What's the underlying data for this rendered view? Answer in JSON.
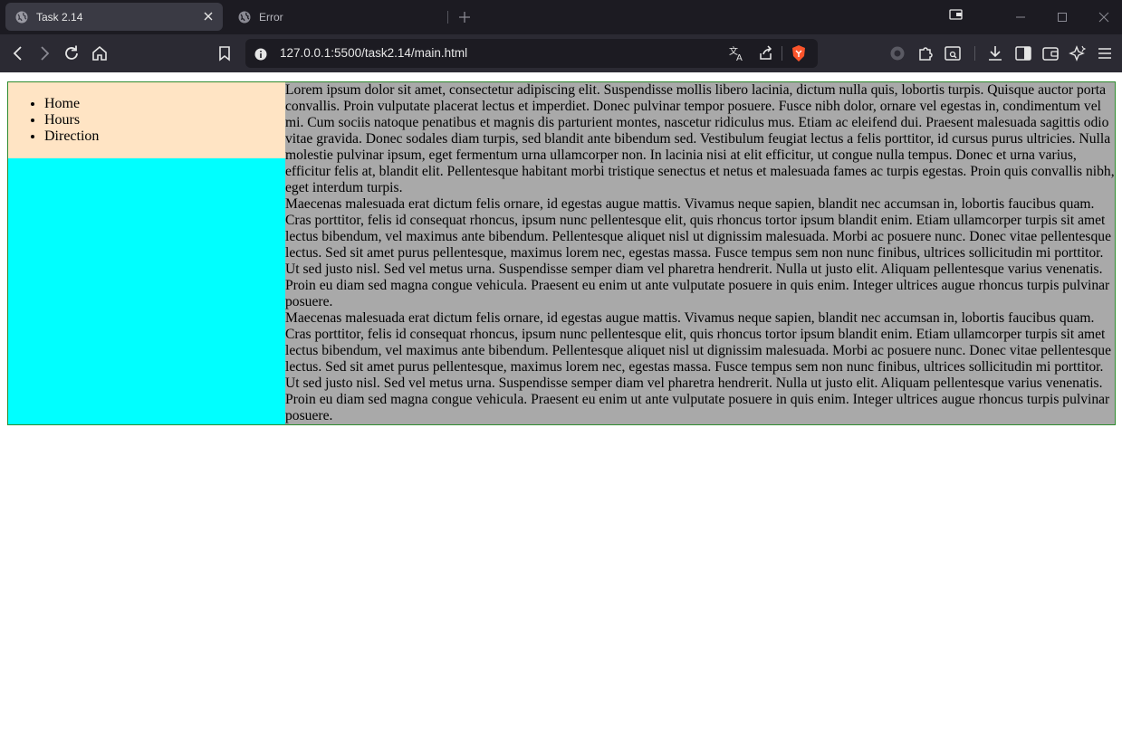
{
  "browser": {
    "tabs": [
      {
        "title": "Task 2.14",
        "active": true
      },
      {
        "title": "Error",
        "active": false
      }
    ],
    "url": "127.0.0.1:5500/task2.14/main.html",
    "colors": {
      "tabbar": "#1c1b22",
      "toolbar": "#2b2a33",
      "urlbar": "#1c1b22",
      "brave": "#fb542b"
    }
  },
  "page": {
    "nav": {
      "items": [
        "Home",
        "Hours",
        "Direction"
      ]
    },
    "content": {
      "paragraphs": [
        "Lorem ipsum dolor sit amet, consectetur adipiscing elit. Suspendisse mollis libero lacinia, dictum nulla quis, lobortis turpis. Quisque auctor porta convallis. Proin vulputate placerat lectus et imperdiet. Donec pulvinar tempor posuere. Fusce nibh dolor, ornare vel egestas in, condimentum vel mi. Cum sociis natoque penatibus et magnis dis parturient montes, nascetur ridiculus mus. Etiam ac eleifend dui. Praesent malesuada sagittis odio vitae gravida. Donec sodales diam turpis, sed blandit ante bibendum sed. Vestibulum feugiat lectus a felis porttitor, id cursus purus ultricies. Nulla molestie pulvinar ipsum, eget fermentum urna ullamcorper non. In lacinia nisi at elit efficitur, ut congue nulla tempus. Donec et urna varius, efficitur felis at, blandit elit. Pellentesque habitant morbi tristique senectus et netus et malesuada fames ac turpis egestas. Proin quis convallis nibh, eget interdum turpis.",
        "Maecenas malesuada erat dictum felis ornare, id egestas augue mattis. Vivamus neque sapien, blandit nec accumsan in, lobortis faucibus quam. Cras porttitor, felis id consequat rhoncus, ipsum nunc pellentesque elit, quis rhoncus tortor ipsum blandit enim. Etiam ullamcorper turpis sit amet lectus bibendum, vel maximus ante bibendum. Pellentesque aliquet nisl ut dignissim malesuada. Morbi ac posuere nunc. Donec vitae pellentesque lectus. Sed sit amet purus pellentesque, maximus lorem nec, egestas massa. Fusce tempus sem non nunc finibus, ultrices sollicitudin mi porttitor. Ut sed justo nisl. Sed vel metus urna. Suspendisse semper diam vel pharetra hendrerit. Nulla ut justo elit. Aliquam pellentesque varius venenatis. Proin eu diam sed magna congue vehicula. Praesent eu enim ut ante vulputate posuere in quis enim. Integer ultrices augue rhoncus turpis pulvinar posuere.",
        "Maecenas malesuada erat dictum felis ornare, id egestas augue mattis. Vivamus neque sapien, blandit nec accumsan in, lobortis faucibus quam. Cras porttitor, felis id consequat rhoncus, ipsum nunc pellentesque elit, quis rhoncus tortor ipsum blandit enim. Etiam ullamcorper turpis sit amet lectus bibendum, vel maximus ante bibendum. Pellentesque aliquet nisl ut dignissim malesuada. Morbi ac posuere nunc. Donec vitae pellentesque lectus. Sed sit amet purus pellentesque, maximus lorem nec, egestas massa. Fusce tempus sem non nunc finibus, ultrices sollicitudin mi porttitor. Ut sed justo nisl. Sed vel metus urna. Suspendisse semper diam vel pharetra hendrerit. Nulla ut justo elit. Aliquam pellentesque varius venenatis. Proin eu diam sed magna congue vehicula. Praesent eu enim ut ante vulputate posuere in quis enim. Integer ultrices augue rhoncus turpis pulvinar posuere."
      ]
    },
    "colors": {
      "nav": "#ffe4c4",
      "aside": "#00ffff",
      "content": "#a9a9a9",
      "border": "#2e8b2e"
    }
  }
}
